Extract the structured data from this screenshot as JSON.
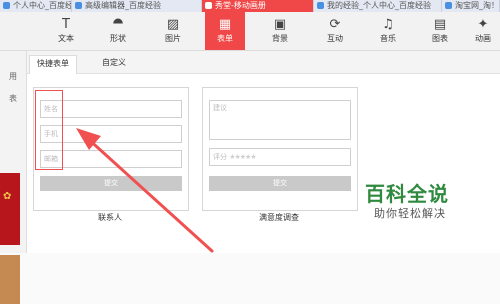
{
  "browser_tabs": [
    {
      "label": "个人中心_百度经验",
      "active": false
    },
    {
      "label": "高级编辑器_百度经验",
      "active": false
    },
    {
      "label": "秀堂-移动画册",
      "active": true
    },
    {
      "label": "我的经验_个人中心_百度经验",
      "active": false
    },
    {
      "label": "淘宝网_淘！",
      "active": false
    }
  ],
  "toolbar": {
    "items": [
      {
        "label": "文本",
        "icon": "text-icon",
        "active": false
      },
      {
        "label": "形状",
        "icon": "shape-icon",
        "active": false
      },
      {
        "label": "图片",
        "icon": "image-icon",
        "active": false
      },
      {
        "label": "表单",
        "icon": "form-icon",
        "active": true
      },
      {
        "label": "背景",
        "icon": "background-icon",
        "active": false
      },
      {
        "label": "互动",
        "icon": "interaction-icon",
        "active": false
      },
      {
        "label": "音乐",
        "icon": "music-icon",
        "active": false
      },
      {
        "label": "图表",
        "icon": "chart-icon",
        "active": false
      },
      {
        "label": "动画",
        "icon": "animation-icon",
        "active": false
      }
    ],
    "accent": "#f04848"
  },
  "left_panel": {
    "items": [
      "用",
      "表"
    ]
  },
  "form_panel": {
    "tabs": [
      {
        "label": "快捷表单",
        "active": true
      },
      {
        "label": "自定义",
        "active": false
      }
    ],
    "contact_card": {
      "fields": [
        {
          "placeholder": "姓名"
        },
        {
          "placeholder": "手机"
        },
        {
          "placeholder": "邮箱"
        }
      ],
      "submit_label": "提交",
      "caption": "联系人"
    },
    "survey_card": {
      "suggestion_placeholder": "建议",
      "rating_label": "评分",
      "rating_stars": "★★★★★",
      "submit_label": "提交",
      "caption": "满意度调查"
    }
  },
  "watermark": {
    "title": "百科全说",
    "subtitle": "助你轻松解决"
  }
}
